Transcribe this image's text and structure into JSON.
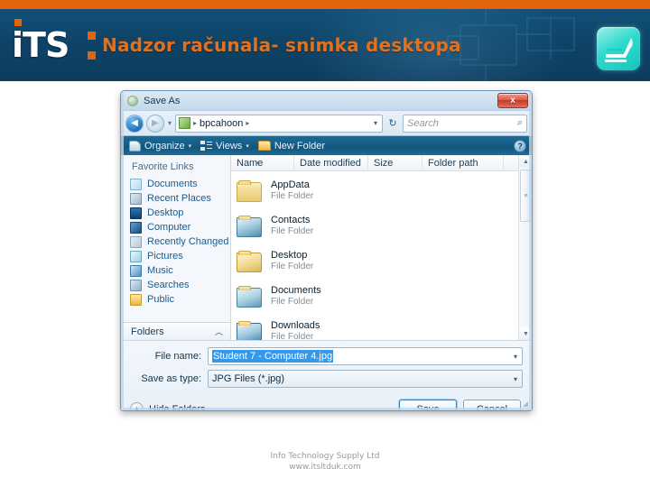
{
  "header": {
    "logo_text": "iTS",
    "title": "Nadzor računala- snimka desktopa",
    "accent_orange": "#e2640b",
    "bg_blue": "#0e4367",
    "icon_color": "#2fd9cd",
    "icon_name": "document-stack-icon"
  },
  "dialog": {
    "titlebar": {
      "title": "Save As",
      "close_label": "x"
    },
    "address": {
      "back_glyph": "◀",
      "forward_glyph": "▶",
      "dropdown_glyph": "▾",
      "breadcrumb": "bpcahoon",
      "crumb_arrow": "▸",
      "refresh_glyph": "↻",
      "search_placeholder": "Search",
      "search_glyph": "⌕"
    },
    "toolbar": {
      "organize_label": "Organize",
      "views_label": "Views",
      "new_folder_label": "New Folder",
      "caret": "▾",
      "help_label": "?"
    },
    "sidebar": {
      "heading": "Favorite Links",
      "items": [
        {
          "label": "Documents",
          "icon": "documents-icon"
        },
        {
          "label": "Recent Places",
          "icon": "recent-places-icon"
        },
        {
          "label": "Desktop",
          "icon": "desktop-icon"
        },
        {
          "label": "Computer",
          "icon": "computer-icon"
        },
        {
          "label": "Recently Changed",
          "icon": "recently-changed-icon"
        },
        {
          "label": "Pictures",
          "icon": "pictures-icon"
        },
        {
          "label": "Music",
          "icon": "music-icon"
        },
        {
          "label": "Searches",
          "icon": "searches-icon"
        },
        {
          "label": "Public",
          "icon": "public-folder-icon"
        }
      ],
      "folders_label": "Folders",
      "folders_chevron": "︿"
    },
    "filelist": {
      "columns": [
        "Name",
        "Date modified",
        "Size",
        "Folder path",
        ""
      ],
      "sort_glyph": "▴",
      "rows": [
        {
          "name": "AppData",
          "type": "File Folder"
        },
        {
          "name": "Contacts",
          "type": "File Folder"
        },
        {
          "name": "Desktop",
          "type": "File Folder"
        },
        {
          "name": "Documents",
          "type": "File Folder"
        },
        {
          "name": "Downloads",
          "type": "File Folder"
        }
      ],
      "scrollbar": {
        "up_glyph": "▲",
        "down_glyph": "▼",
        "thumb_grip": "≡"
      }
    },
    "form": {
      "file_name_label": "File name:",
      "file_name_value": "Student 7 - Computer 4.jpg",
      "save_as_type_label": "Save as type:",
      "save_as_type_value": "JPG Files (*.jpg)",
      "combo_caret": "▾",
      "hide_folders_label": "Hide Folders",
      "hide_folders_glyph": "▲",
      "save_button": "Save",
      "cancel_button": "Cancel",
      "resizer_glyph": "◢"
    }
  },
  "footer": {
    "line1": "Info Technology Supply Ltd",
    "line2": "www.itsltduk.com"
  }
}
